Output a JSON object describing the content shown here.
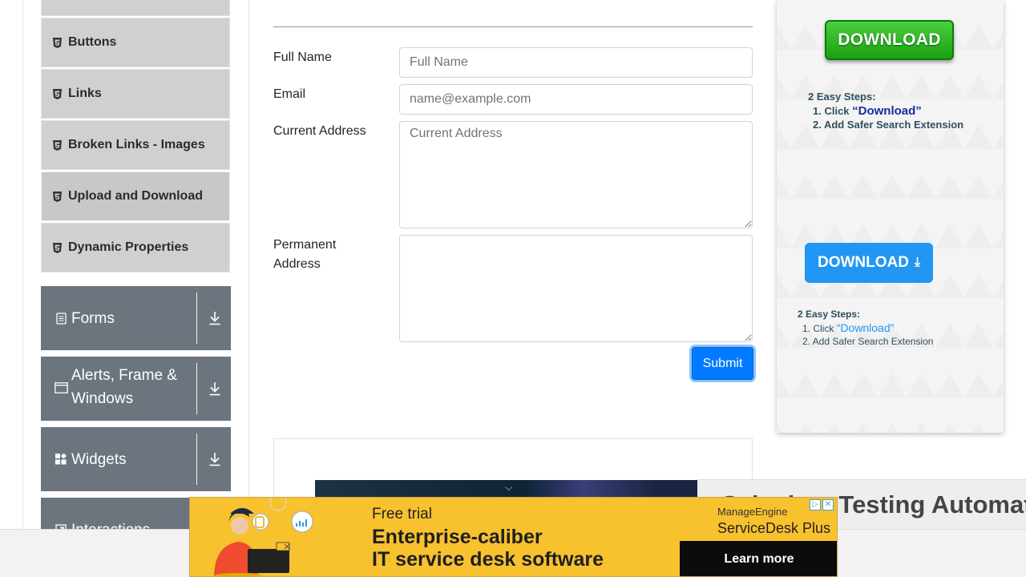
{
  "sidebar": {
    "sub_items": [
      {
        "label": "Buttons",
        "icon": "html5-icon"
      },
      {
        "label": "Links",
        "icon": "html5-icon"
      },
      {
        "label": "Broken Links - Images",
        "icon": "html5-icon"
      },
      {
        "label": "Upload and Download",
        "icon": "html5-icon"
      },
      {
        "label": "Dynamic Properties",
        "icon": "html5-icon"
      }
    ],
    "groups": [
      {
        "label": "Forms",
        "icon": "document-icon"
      },
      {
        "label": "Alerts, Frame & Windows",
        "icon": "window-icon"
      },
      {
        "label": "Widgets",
        "icon": "widgets-icon"
      },
      {
        "label": "Interactions",
        "icon": "interactions-icon"
      }
    ]
  },
  "form": {
    "full_name": {
      "label": "Full Name",
      "placeholder": "Full Name",
      "value": ""
    },
    "email": {
      "label": "Email",
      "placeholder": "name@example.com",
      "value": ""
    },
    "current_address": {
      "label": "Current Address",
      "placeholder": "Current Address",
      "value": ""
    },
    "permanent_address": {
      "label": "Permanent Address",
      "placeholder": "",
      "value": ""
    },
    "submit_label": "Submit"
  },
  "right_ad": {
    "download_green": "DOWNLOAD",
    "steps_title": "2 Easy Steps:",
    "step1_prefix": "1. Click ",
    "step1_link": "“Download”",
    "step2": "2. Add Safer Search Extension",
    "download_blue": "DOWNLOAD",
    "download_blue_icon": "⤓"
  },
  "sticky_title": "Selenium Testing Automation",
  "banner": {
    "trial": "Free trial",
    "line1": "Enterprise-caliber",
    "line2": "IT service desk software",
    "brand_top": "ManageEngine",
    "brand_bottom": "ServiceDesk Plus",
    "cta": "Learn more"
  },
  "colors": {
    "group_bg": "#6c757d",
    "sub_item_bg": "#d0d0d0",
    "primary": "#007bff",
    "banner_bg": "#f8c12e"
  }
}
